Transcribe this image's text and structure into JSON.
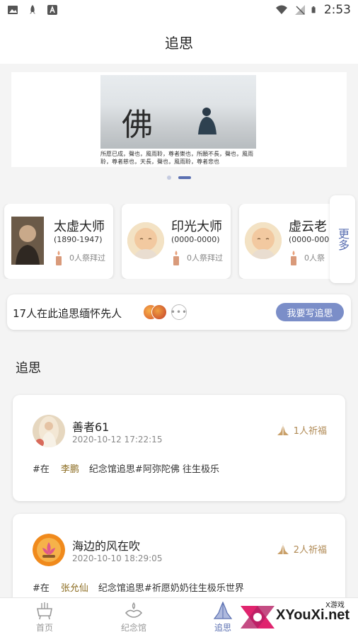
{
  "status_bar": {
    "time": "2:53"
  },
  "header": {
    "title": "追思"
  },
  "banner": {
    "calligraphy": "佛",
    "caption": "所愿已成，聲也，風雨聆，尊者樂也，所願不長，聲也，風雨聆，尊者慈也，天長，聲也，風雨聆，尊者悲也"
  },
  "masters": [
    {
      "name": "太虚大师",
      "dates": "(1890-1947)",
      "worship": "0人祭拜过"
    },
    {
      "name": "印光大师",
      "dates": "(0000-0000)",
      "worship": "0人祭拜过"
    },
    {
      "name": "虚云老",
      "dates": "(0000-000",
      "worship": "0人祭"
    }
  ],
  "more_label": "更多",
  "summary": {
    "text": "17人在此追思缅怀先人",
    "more_dots": "•••",
    "write_button": "我要写追思"
  },
  "section": {
    "title": "追思"
  },
  "posts": [
    {
      "name": "善者61",
      "time": "2020-10-12 17:22:15",
      "bless": "1人祈福",
      "prefix": "#在",
      "tag_name": "李鹏",
      "content": "纪念馆追思#阿弥陀佛 往生极乐"
    },
    {
      "name": "海边的风在吹",
      "time": "2020-10-10 18:29:05",
      "bless": "2人祈福",
      "prefix": "#在",
      "tag_name": "张允仙",
      "content": "纪念馆追思#祈愿奶奶往生极乐世界"
    }
  ],
  "nav": [
    {
      "label": "首页",
      "icon": "incense-burner-icon"
    },
    {
      "label": "纪念馆",
      "icon": "lotus-lamp-icon"
    },
    {
      "label": "追思",
      "icon": "praying-hands-icon"
    }
  ],
  "watermark": {
    "text": "XYouXi.net",
    "sub": "X游戏"
  },
  "colors": {
    "accent": "#5a6fb1",
    "bless": "#b08a55",
    "button": "#7b8ec8"
  }
}
